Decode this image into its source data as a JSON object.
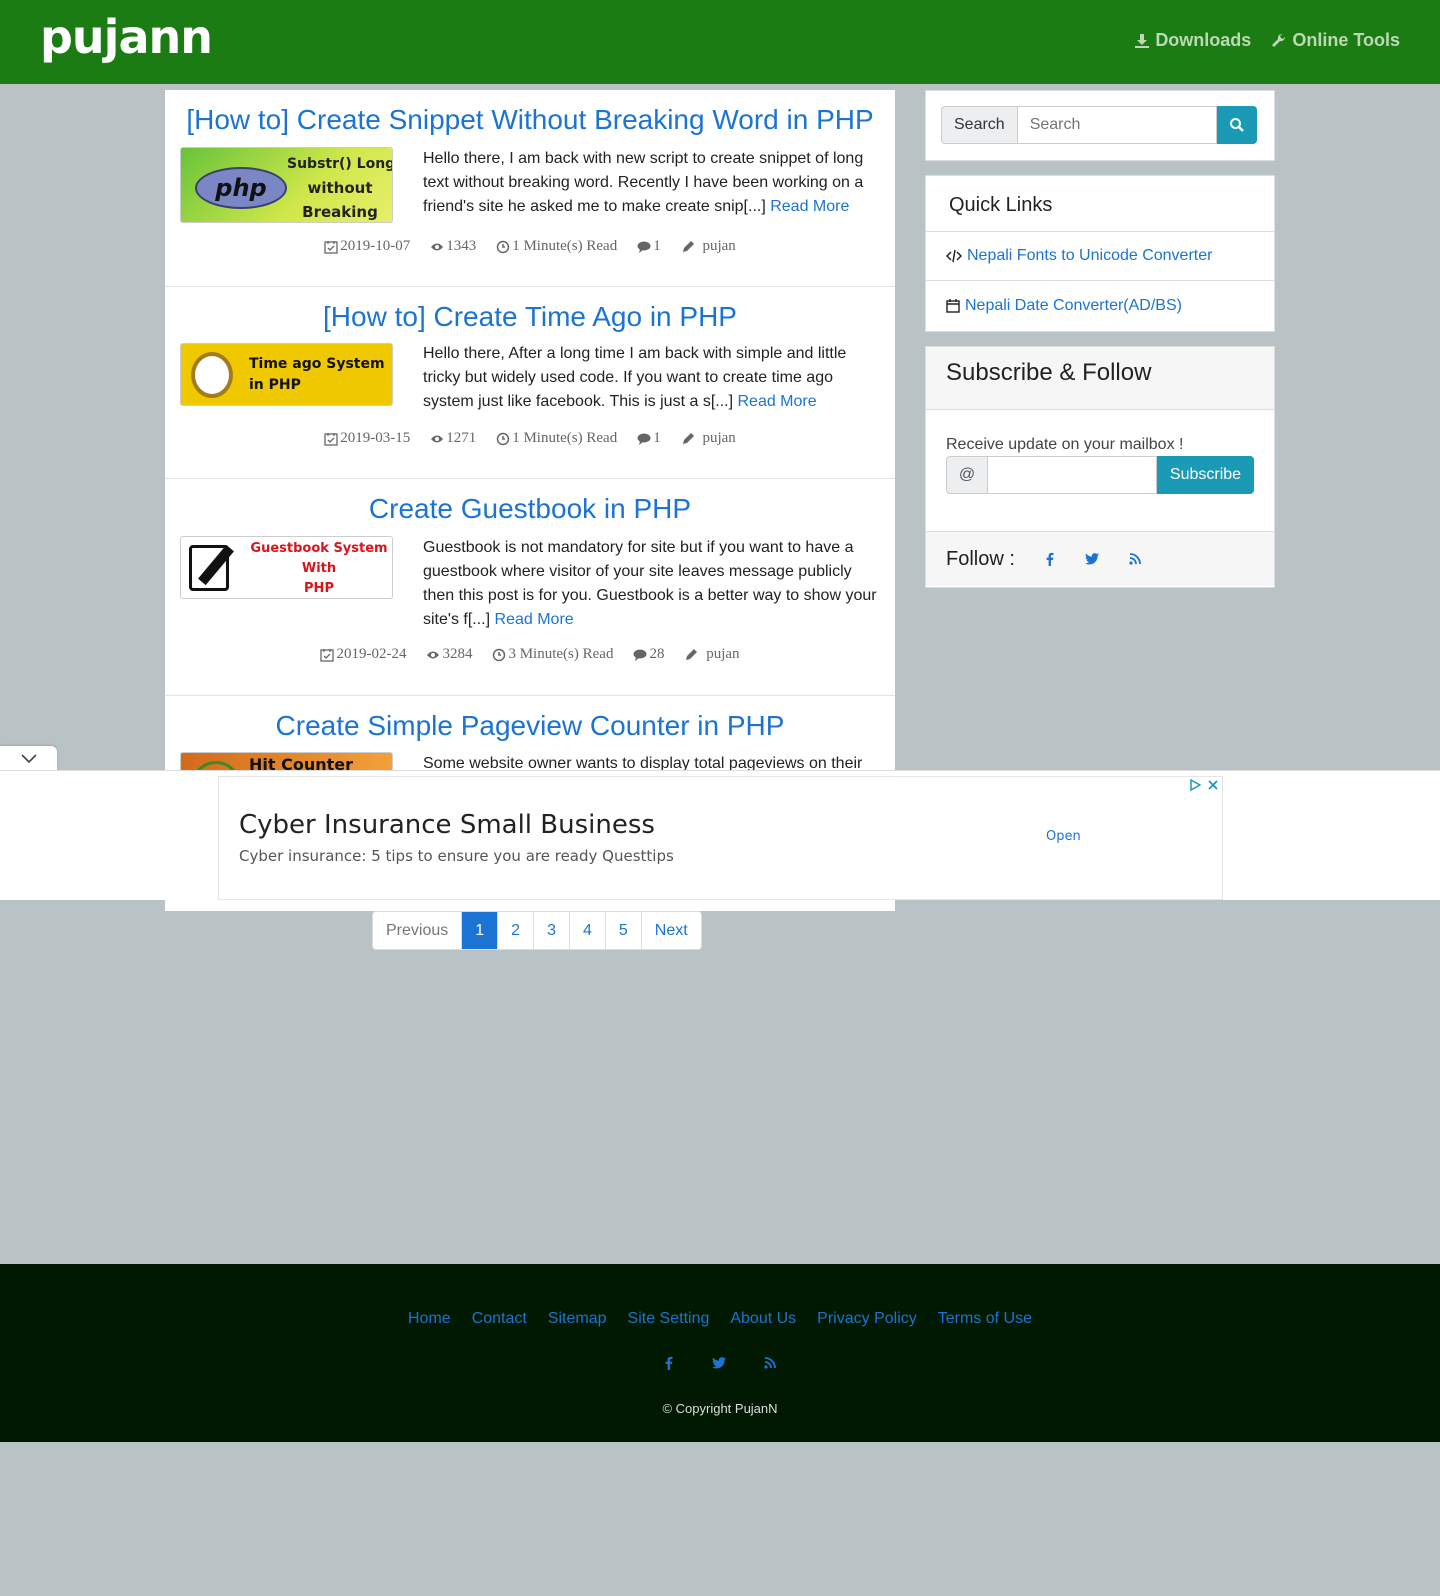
{
  "site": {
    "logo": "pujann"
  },
  "nav": [
    {
      "label": "Downloads",
      "icon": "download-icon"
    },
    {
      "label": "Online Tools",
      "icon": "wrench-icon"
    }
  ],
  "posts": [
    {
      "title": "[How to] Create Snippet Without Breaking Word in PHP",
      "thumb_lines": [
        "Substr() Long Text",
        "without",
        "Breaking Word"
      ],
      "thumb_badge": "php",
      "excerpt": "Hello there, I am back with new script to create snippet of long text without breaking word. Recently I have been working on a friend's site he asked me to make create snip[...] ",
      "read_more": "Read More",
      "date": "2019-10-07",
      "views": "1343",
      "read_time": "1 Minute(s) Read",
      "comments": "1",
      "author": "pujan"
    },
    {
      "title": "[How to] Create Time Ago in PHP",
      "thumb_lines": [
        "Time ago System",
        "in PHP"
      ],
      "excerpt": " Hello there, After a long time I am back with simple and little tricky but widely used code. If you want to create time ago system just like facebook. This is just a s[...] ",
      "read_more": "Read More",
      "date": "2019-03-15",
      "views": "1271",
      "read_time": "1 Minute(s) Read",
      "comments": "1",
      "author": "pujan"
    },
    {
      "title": "Create Guestbook in PHP",
      "thumb_lines": [
        "Guestbook System",
        "With",
        "PHP"
      ],
      "excerpt": "Guestbook is not mandatory for site but if you want to have a guestbook where visitor of your site leaves message publicly then this post is for you. Guestbook is a better way to show your site's f[...] ",
      "read_more": "Read More",
      "date": "2019-02-24",
      "views": "3284",
      "read_time": "3 Minute(s) Read",
      "comments": "28",
      "author": "pujan"
    },
    {
      "title": "Create Simple Pageview Counter in PHP",
      "thumb_lines": [
        "Hit Counter"
      ],
      "excerpt": "Some website owner wants to display total pageviews on their"
    }
  ],
  "pagination": {
    "prev": "Previous",
    "pages": [
      "1",
      "2",
      "3",
      "4",
      "5"
    ],
    "next": "Next",
    "active": "1"
  },
  "sidebar": {
    "search_label": "Search",
    "search_placeholder": "Search",
    "quick_links_title": "Quick Links",
    "quick_links": [
      {
        "label": "Nepali Fonts to Unicode Converter",
        "icon": "code-icon"
      },
      {
        "label": "Nepali Date Converter(AD/BS)",
        "icon": "calendar-icon"
      }
    ],
    "subscribe_title": "Subscribe & Follow",
    "subscribe_text": "Receive update on your mailbox !",
    "subscribe_at": "@",
    "subscribe_button": "Subscribe",
    "follow_label": "Follow :"
  },
  "ad": {
    "title": "Cyber Insurance Small Business",
    "subtitle": "Cyber insurance: 5 tips to ensure you are ready Questtips",
    "open": "Open"
  },
  "footer": {
    "links": [
      "Home",
      "Contact",
      "Sitemap",
      "Site Setting",
      "About Us",
      "Privacy Policy",
      "Terms of Use"
    ],
    "copyright": "© Copyright PujanN"
  },
  "colors": {
    "header": "#1a7c12",
    "link": "#1b74d3",
    "accent": "#1b9ab5",
    "footer": "#001900",
    "page_bg": "#b9c2c4"
  }
}
